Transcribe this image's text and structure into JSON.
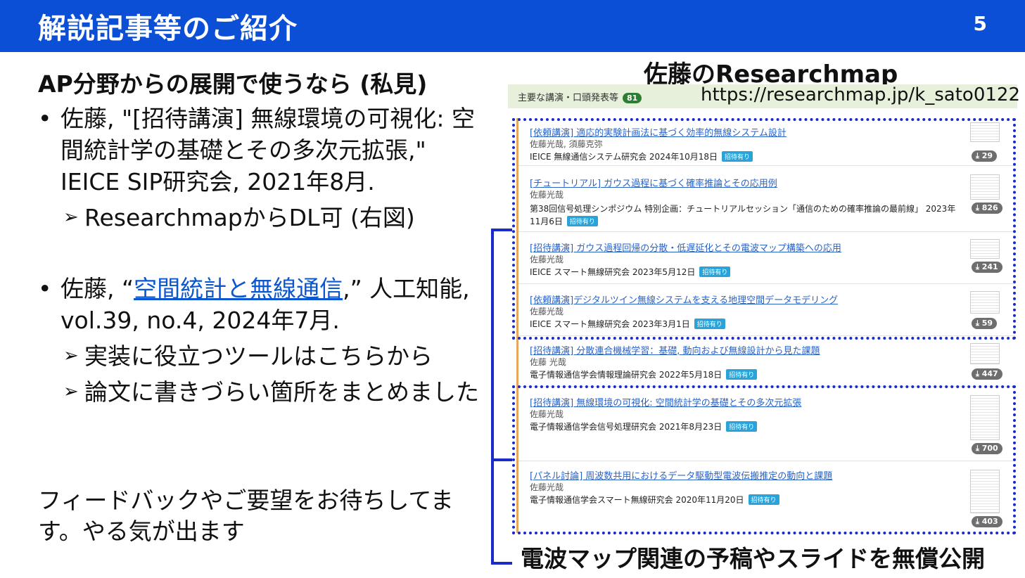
{
  "header": {
    "title": "解説記事等のご紹介",
    "page_number": "5"
  },
  "left": {
    "heading": "AP分野からの展開で使うなら (私見)",
    "bullets": [
      {
        "dot": "•",
        "text": "佐藤, \"[招待講演] 無線環境の可視化: 空間統計学の基礎とその多次元拡張,\" IEICE SIP研究会, 2021年8月.",
        "subs": [
          "ResearchmapからDL可 (右図)"
        ]
      },
      {
        "dot": "•",
        "prefix": "佐藤, “",
        "link": "空間統計と無線通信",
        "suffix": ",” 人工知能, vol.39, no.4, 2024年7月.",
        "subs": [
          "実装に役立つツールはこちらから",
          "論文に書きづらい箇所をまとめました"
        ]
      }
    ],
    "arrow": "➢",
    "feedback": "フィードバックやご要望をお待ちしてます。やる気が出ます"
  },
  "right": {
    "title": "佐藤のResearchmap",
    "header_label": "主要な講演・口頭発表等",
    "header_count": "81",
    "url": "https://researchmap.jp/k_sato0122",
    "tag": "招待有り",
    "items": [
      {
        "title": "[依頼講演] 適応的実験計画法に基づく効率的無線システム設計",
        "authors": "佐藤光哉, 須藤克弥",
        "venue": "IEICE 無線通信システム研究会 2024年10月18日",
        "downloads": "29"
      },
      {
        "title": "[チュートリアル] ガウス過程に基づく確率推論とその応用例",
        "authors": "佐藤光哉",
        "venue": "第38回信号処理シンポジウム 特別企画：チュートリアルセッション「通信のための確率推論の最前線」 2023年",
        "venue2": "11月6日",
        "downloads": "826"
      },
      {
        "title": "[招待講演] ガウス過程回帰の分散・低遅延化とその電波マップ構築への応用",
        "authors": "佐藤光哉",
        "venue": "IEICE スマート無線研究会 2023年5月12日",
        "downloads": "241"
      },
      {
        "title": "[依頼講演]デジタルツイン無線システムを支える地理空間データモデリング",
        "authors": "佐藤光哉",
        "venue": "IEICE スマート無線研究会 2023年3月1日",
        "downloads": "59"
      },
      {
        "title": "[招待講演] 分散連合機械学習：基礎, 動向および無線設計から見た課題",
        "authors": "佐藤 光哉",
        "venue": "電子情報通信学会情報理論研究会 2022年5月18日",
        "downloads": "447"
      },
      {
        "title": "[招待講演] 無線環境の可視化: 空間統計学の基礎とその多次元拡張",
        "authors": "佐藤光哉",
        "venue": "電子情報通信学会信号処理研究会 2021年8月23日",
        "downloads": "700"
      },
      {
        "title": "[パネル討論] 周波数共用におけるデータ駆動型電波伝搬推定の動向と課題",
        "authors": "佐藤光哉",
        "venue": "電子情報通信学会スマート無線研究会 2020年11月20日",
        "downloads": "403"
      }
    ],
    "caption": "電波マップ関連の予稿やスライドを無償公開"
  }
}
